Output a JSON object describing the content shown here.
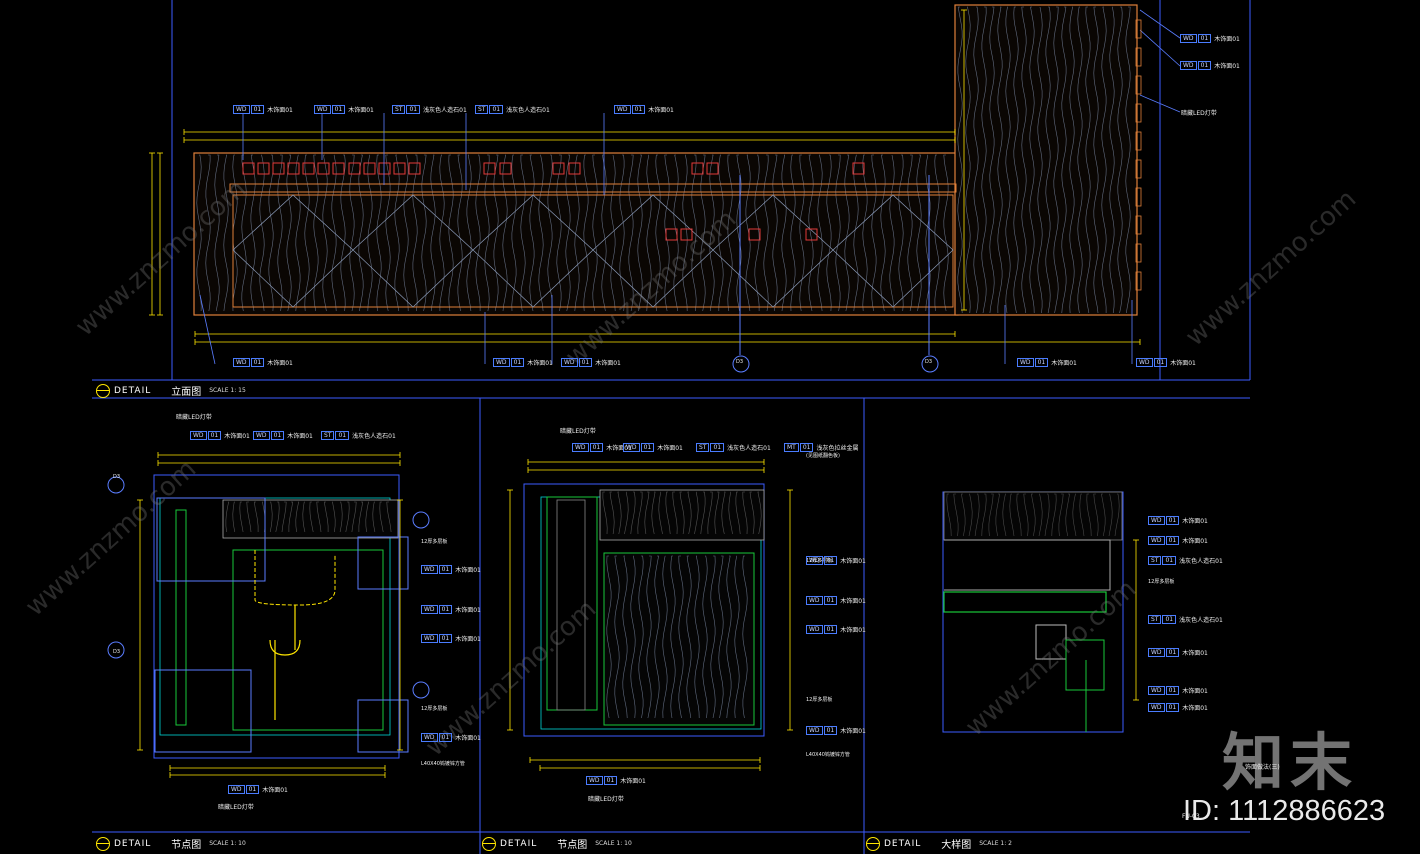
{
  "drawing_titles": [
    {
      "prefix": "DETAIL",
      "name": "立面图",
      "scale": "SCALE 1: 15"
    },
    {
      "prefix": "DETAIL",
      "name": "节点图",
      "scale": "SCALE 1: 10"
    },
    {
      "prefix": "DETAIL",
      "name": "节点图",
      "scale": "SCALE 1: 10"
    },
    {
      "prefix": "DETAIL",
      "name": "大样图",
      "scale": "SCALE 1: 2"
    }
  ],
  "elevation_tags": {
    "top_left_1": {
      "code": "WD",
      "sub": "01",
      "desc": "木饰面01"
    },
    "top_left_2": {
      "code": "WD",
      "sub": "01",
      "desc": "木饰面01"
    },
    "top_st_1": {
      "code": "ST",
      "sub": "01",
      "desc": "浅灰色人造石01"
    },
    "top_st_2": {
      "code": "ST",
      "sub": "01",
      "desc": "浅灰色人造石01"
    },
    "top_wd_mid": {
      "code": "WD",
      "sub": "01",
      "desc": "木饰面01"
    },
    "right_1": {
      "code": "WD",
      "sub": "01",
      "desc": "木饰面01"
    },
    "right_2": {
      "code": "WD",
      "sub": "01",
      "desc": "木饰面01"
    },
    "right_led": "暗藏LED灯带",
    "bottom_1": {
      "code": "WD",
      "sub": "01",
      "desc": "木饰面01"
    },
    "bottom_2": {
      "code": "WD",
      "sub": "01",
      "desc": "木饰面01"
    },
    "bottom_3": {
      "code": "WD",
      "sub": "01",
      "desc": "木饰面01"
    },
    "bottom_4": {
      "code": "WD",
      "sub": "01",
      "desc": "木饰面01"
    },
    "bottom_5": {
      "code": "WD",
      "sub": "01",
      "desc": "木饰面01"
    }
  },
  "detail1_tags": {
    "led_top": "暗藏LED灯带",
    "wd_a": {
      "code": "WD",
      "sub": "01",
      "desc": "木饰面01"
    },
    "wd_b": {
      "code": "WD",
      "sub": "01",
      "desc": "木饰面01"
    },
    "st": {
      "code": "ST",
      "sub": "01",
      "desc": "浅灰色人造石01"
    },
    "board": "12厚多层板",
    "wd_c": {
      "code": "WD",
      "sub": "01",
      "desc": "木饰面01"
    },
    "wd_d": {
      "code": "WD",
      "sub": "01",
      "desc": "木饰面01"
    },
    "wd_e": {
      "code": "WD",
      "sub": "01",
      "desc": "木饰面01"
    },
    "board2": "12厚多层板",
    "wd_f": {
      "code": "WD",
      "sub": "01",
      "desc": "木饰面01"
    },
    "pipe": "L40X40钨镀锌方管",
    "wd_bottom": {
      "code": "WD",
      "sub": "01",
      "desc": "木饰面01"
    },
    "led_bottom": "暗藏LED灯带"
  },
  "detail2_tags": {
    "led_top": "暗藏LED灯带",
    "wd_a": {
      "code": "WD",
      "sub": "01",
      "desc": "木饰面01"
    },
    "wd_b": {
      "code": "WD",
      "sub": "01",
      "desc": "木饰面01"
    },
    "st": {
      "code": "ST",
      "sub": "01",
      "desc": "浅灰色人造石01"
    },
    "mt": {
      "code": "MT",
      "sub": "01",
      "desc": "浅灰色拉丝金属"
    },
    "mt_note": "(见图纸翻色板)",
    "board": "12厚多层板",
    "wd_c": {
      "code": "WD",
      "sub": "01",
      "desc": "木饰面01"
    },
    "wd_d": {
      "code": "WD",
      "sub": "01",
      "desc": "木饰面01"
    },
    "wd_e": {
      "code": "WD",
      "sub": "01",
      "desc": "木饰面01"
    },
    "board2": "12厚多层板",
    "wd_f": {
      "code": "WD",
      "sub": "01",
      "desc": "木饰面01"
    },
    "pipe": "L40X40钨镀锌方管",
    "wd_bottom": {
      "code": "WD",
      "sub": "01",
      "desc": "木饰面01"
    },
    "led_bottom": "暗藏LED灯带"
  },
  "detail3_tags": {
    "wd_a": {
      "code": "WD",
      "sub": "01",
      "desc": "木饰面01"
    },
    "wd_b": {
      "code": "WD",
      "sub": "01",
      "desc": "木饰面01"
    },
    "st_a": {
      "code": "ST",
      "sub": "01",
      "desc": "浅灰色人造石01"
    },
    "board": "12厚多层板",
    "st_b": {
      "code": "ST",
      "sub": "01",
      "desc": "浅灰色人造石01"
    },
    "wd_c": {
      "code": "WD",
      "sub": "01",
      "desc": "木饰面01"
    },
    "wd_d": {
      "code": "WD",
      "sub": "01",
      "desc": "木饰面01"
    },
    "wd_e": {
      "code": "WD",
      "sub": "01",
      "desc": "木饰面01"
    },
    "note": "饰面做法(三)"
  },
  "section_refs": [
    "D3",
    "D3",
    "D3",
    "D3"
  ],
  "sheet_no": "FU-03",
  "watermark": {
    "logo": "知末",
    "id": "ID: 1112886623",
    "url": "www.znzmo.com"
  },
  "colors": {
    "bg": "#000000",
    "frame": "#3c5cff",
    "wood": "#e0803a",
    "grain": "#8a9ab8",
    "dim": "#ffe600",
    "leader": "#5a7dff",
    "green": "#19c83a",
    "cyan": "#00d8d8"
  }
}
